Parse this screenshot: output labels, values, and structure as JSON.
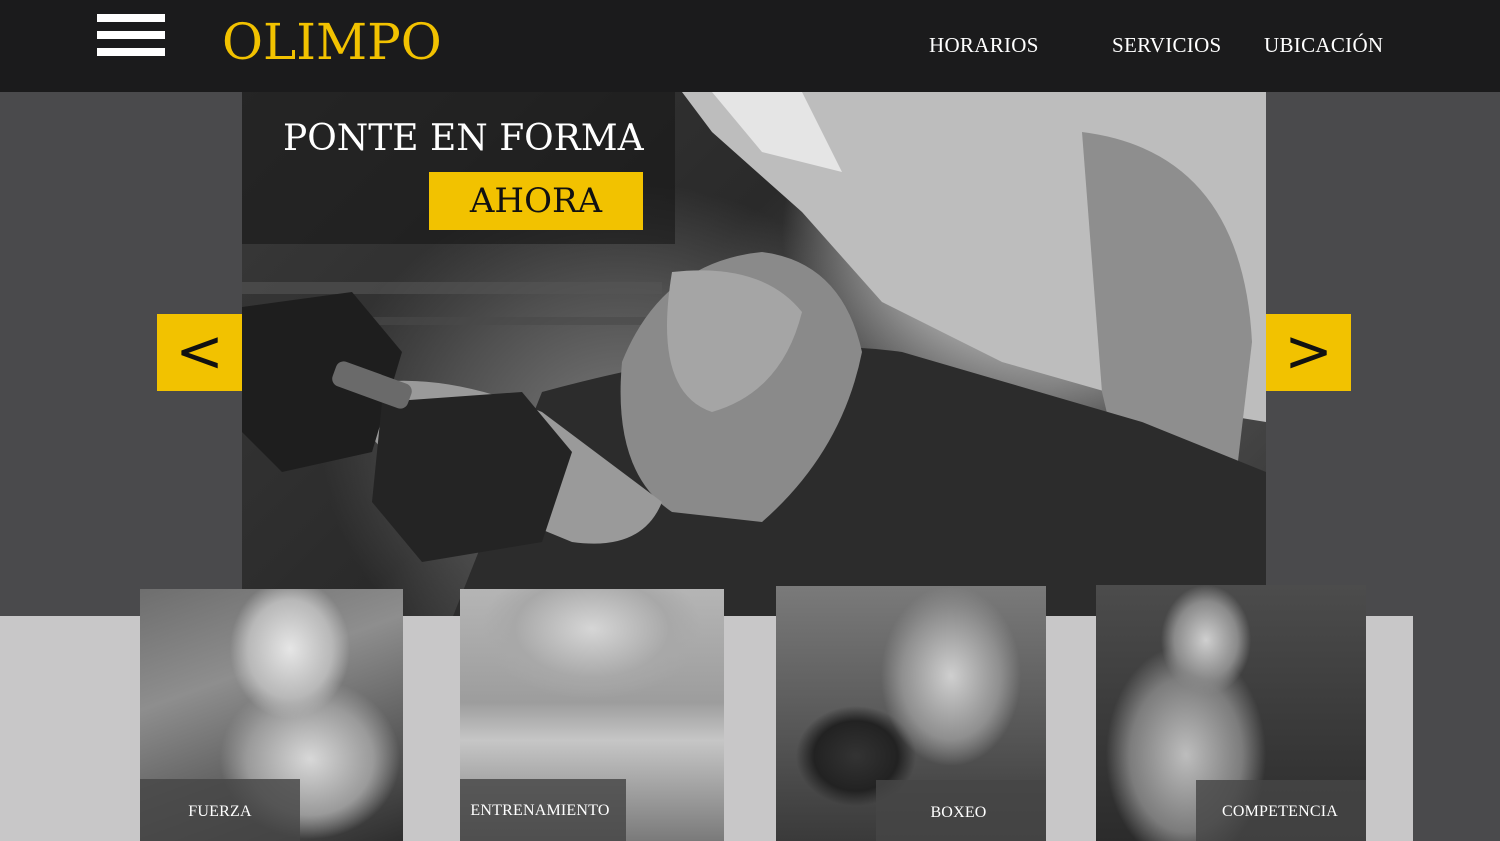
{
  "brand": {
    "name": "OLIMPO",
    "color": "#f2c200"
  },
  "menu": {
    "icon": "hamburger-menu-icon"
  },
  "nav": {
    "items": [
      "HORARIOS",
      "SERVICIOS",
      "UBICACIÓN"
    ]
  },
  "hero": {
    "headline": "PONTE EN FORMA",
    "cta": "AHORA",
    "accent": "#f2c200",
    "prev_label": "<",
    "next_label": ">",
    "image": "weightlifter-dumbbell-curl-photo"
  },
  "cards": [
    {
      "label": "FUERZA",
      "image": "woman-leg-press-photo"
    },
    {
      "label": "ENTRENAMIENTO",
      "image": "woman-barbell-curl-photo"
    },
    {
      "label": "BOXEO",
      "image": "boxer-portrait-photo"
    },
    {
      "label": "COMPETENCIA",
      "image": "man-cable-pull-photo"
    }
  ]
}
